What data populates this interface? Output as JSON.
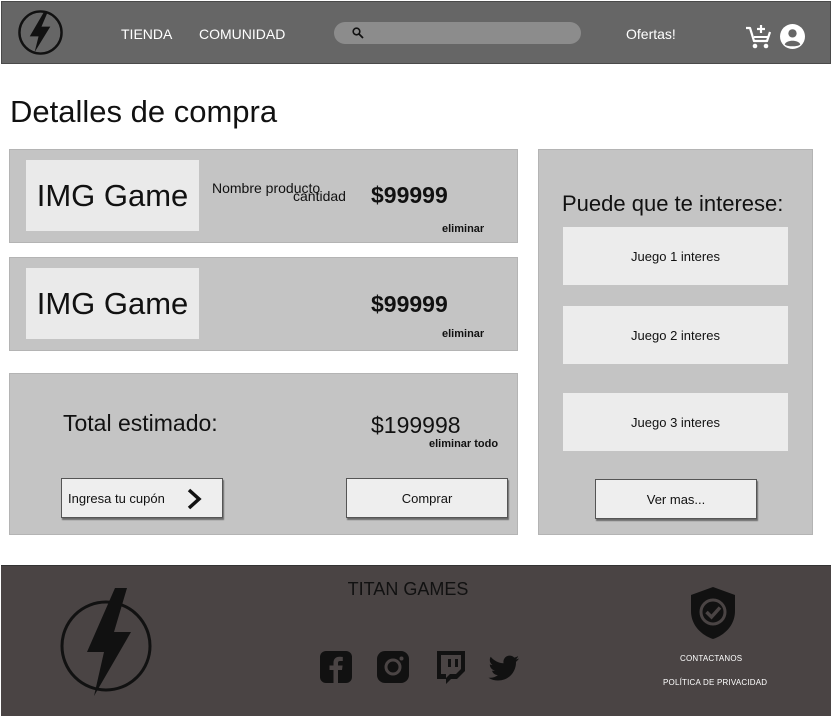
{
  "navbar": {
    "links": [
      "TIENDA",
      "COMUNIDAD"
    ],
    "search_placeholder": "",
    "offers": "Ofertas!"
  },
  "page": {
    "title": "Detalles de compra"
  },
  "cart": {
    "items": [
      {
        "image_label": "IMG Game",
        "name": "Nombre producto",
        "quantity_label": "cantidad",
        "price": "$99999",
        "remove": "eliminar"
      },
      {
        "image_label": "IMG Game",
        "name": "",
        "quantity_label": "",
        "price": "$99999",
        "remove": "eliminar"
      }
    ],
    "total_label": "Total estimado:",
    "total_value": "$199998",
    "remove_all": "eliminar todo",
    "coupon_button": "Ingresa tu cupón",
    "buy_button": "Comprar"
  },
  "recommendations": {
    "title": "Puede que te interese:",
    "items": [
      "Juego 1 interes",
      "Juego 2 interes",
      "Juego 3 interes"
    ],
    "more_button": "Ver mas..."
  },
  "footer": {
    "brand": "TITAN GAMES",
    "social": [
      "facebook-icon",
      "instagram-icon",
      "twitch-icon",
      "twitter-icon"
    ],
    "contact": "CONTACTANOS",
    "privacy": "POLÍTICA DE PRIVACIDAD"
  },
  "colors": {
    "navbar": "#666666",
    "panel": "#c4c4c4",
    "card": "#eaeaea",
    "footer": "#4a4444"
  }
}
